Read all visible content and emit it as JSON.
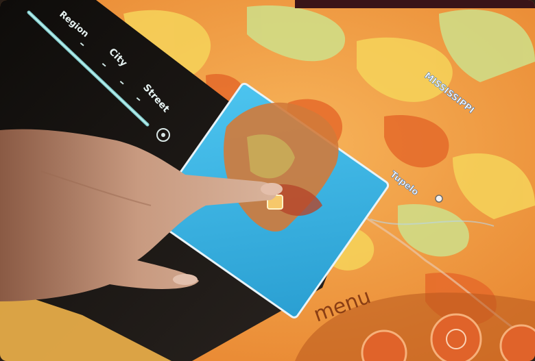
{
  "zoom_slider": {
    "labels": [
      "Region",
      "City",
      "Street"
    ],
    "level_fraction": 0.78
  },
  "map_labels": {
    "state": "MISSISSIPPI",
    "city": "Tupelo"
  },
  "menu_label": "menu",
  "colors": {
    "map_orange": "#f2a23a",
    "map_yellow": "#f6d45a",
    "map_green": "#cfe08a",
    "inset_blue": "#3ab7e6",
    "bezel": "#1b1612",
    "skin": "#c99a7e"
  }
}
